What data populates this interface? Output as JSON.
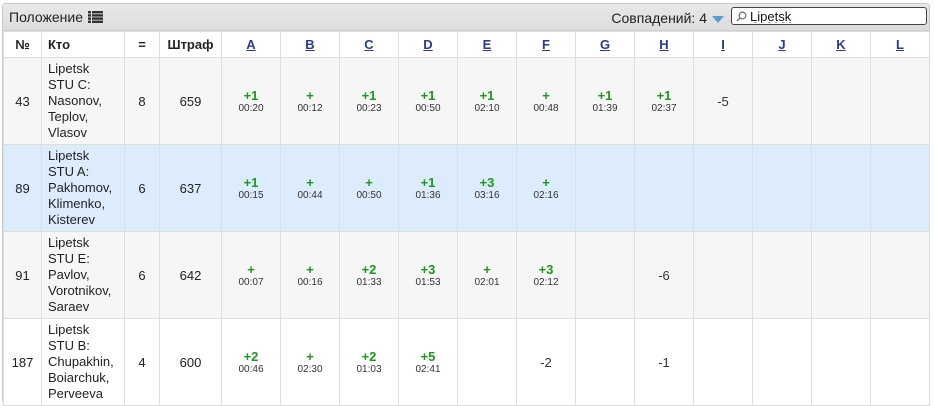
{
  "header": {
    "title": "Положение",
    "matches_label": "Совпадений: 4",
    "search_value": "Lipetsk"
  },
  "columns": {
    "num": "№",
    "who": "Кто",
    "solved": "=",
    "penalty": "Штраф",
    "problems": [
      "A",
      "B",
      "C",
      "D",
      "E",
      "F",
      "G",
      "H",
      "I",
      "J",
      "K",
      "L"
    ]
  },
  "rows": [
    {
      "place": "43",
      "team": [
        "Lipetsk",
        "STU C:",
        "Nasonov,",
        "Teplov,",
        "Vlasov"
      ],
      "solved": "8",
      "penalty": "659",
      "cells": [
        {
          "r": "+1",
          "t": "00:20"
        },
        {
          "r": "+",
          "t": "00:12"
        },
        {
          "r": "+1",
          "t": "00:23"
        },
        {
          "r": "+1",
          "t": "00:50"
        },
        {
          "r": "+1",
          "t": "02:10"
        },
        {
          "r": "+",
          "t": "00:48"
        },
        {
          "r": "+1",
          "t": "01:39"
        },
        {
          "r": "+1",
          "t": "02:37"
        },
        {
          "r": "-5",
          "t": ""
        },
        {
          "r": "",
          "t": ""
        },
        {
          "r": "",
          "t": ""
        },
        {
          "r": "",
          "t": ""
        }
      ]
    },
    {
      "place": "89",
      "team": [
        "Lipetsk",
        "STU A:",
        "Pakhomov,",
        "Klimenko,",
        "Kisterev"
      ],
      "solved": "6",
      "penalty": "637",
      "cells": [
        {
          "r": "+1",
          "t": "00:15"
        },
        {
          "r": "+",
          "t": "00:44"
        },
        {
          "r": "+",
          "t": "00:50"
        },
        {
          "r": "+1",
          "t": "01:36"
        },
        {
          "r": "+3",
          "t": "03:16"
        },
        {
          "r": "+",
          "t": "02:16"
        },
        {
          "r": "",
          "t": ""
        },
        {
          "r": "",
          "t": ""
        },
        {
          "r": "",
          "t": ""
        },
        {
          "r": "",
          "t": ""
        },
        {
          "r": "",
          "t": ""
        },
        {
          "r": "",
          "t": ""
        }
      ]
    },
    {
      "place": "91",
      "team": [
        "Lipetsk",
        "STU E:",
        "Pavlov,",
        "Vorotnikov,",
        "Saraev"
      ],
      "solved": "6",
      "penalty": "642",
      "cells": [
        {
          "r": "+",
          "t": "00:07"
        },
        {
          "r": "+",
          "t": "00:16"
        },
        {
          "r": "+2",
          "t": "01:33"
        },
        {
          "r": "+3",
          "t": "01:53"
        },
        {
          "r": "+",
          "t": "02:01"
        },
        {
          "r": "+3",
          "t": "02:12"
        },
        {
          "r": "",
          "t": ""
        },
        {
          "r": "-6",
          "t": ""
        },
        {
          "r": "",
          "t": ""
        },
        {
          "r": "",
          "t": ""
        },
        {
          "r": "",
          "t": ""
        },
        {
          "r": "",
          "t": ""
        }
      ]
    },
    {
      "place": "187",
      "team": [
        "Lipetsk",
        "STU B:",
        "Chupakhin,",
        "Boiarchuk,",
        "Perveeva"
      ],
      "solved": "4",
      "penalty": "600",
      "cells": [
        {
          "r": "+2",
          "t": "00:46"
        },
        {
          "r": "+",
          "t": "02:30"
        },
        {
          "r": "+2",
          "t": "01:03"
        },
        {
          "r": "+5",
          "t": "02:41"
        },
        {
          "r": "",
          "t": ""
        },
        {
          "r": "-2",
          "t": ""
        },
        {
          "r": "",
          "t": ""
        },
        {
          "r": "-1",
          "t": ""
        },
        {
          "r": "",
          "t": ""
        },
        {
          "r": "",
          "t": ""
        },
        {
          "r": "",
          "t": ""
        },
        {
          "r": "",
          "t": ""
        }
      ]
    }
  ],
  "colors": {
    "accepted": "#1a9a1a",
    "highlight": "#dcecfc",
    "link": "#2a3a9a"
  }
}
